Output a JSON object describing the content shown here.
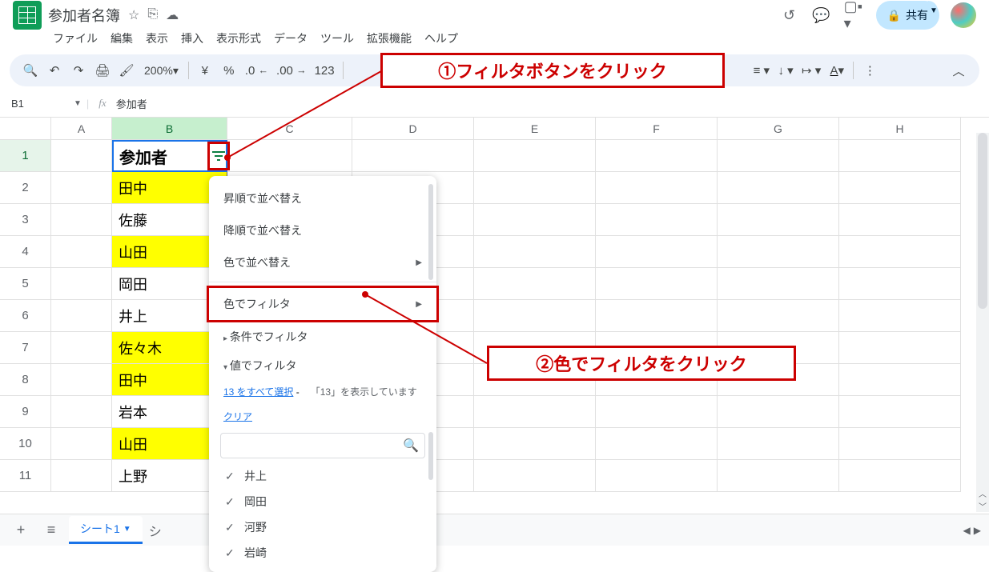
{
  "doc": {
    "title": "参加者名簿"
  },
  "menu": {
    "file": "ファイル",
    "edit": "編集",
    "view": "表示",
    "insert": "挿入",
    "format": "表示形式",
    "data": "データ",
    "tools": "ツール",
    "ext": "拡張機能",
    "help": "ヘルプ"
  },
  "toolbar": {
    "zoom": "200%",
    "yen": "¥",
    "pct": "%",
    "dec_dec": ".0",
    "dec_inc": ".00",
    "num": "123"
  },
  "namebox": {
    "cell": "B1",
    "value": "参加者"
  },
  "columns": [
    "A",
    "B",
    "C",
    "D",
    "E",
    "F",
    "G",
    "H"
  ],
  "rows": [
    {
      "n": "1",
      "b": "参加者",
      "hl": false,
      "head": true
    },
    {
      "n": "2",
      "b": "田中",
      "hl": true
    },
    {
      "n": "3",
      "b": "佐藤",
      "hl": false
    },
    {
      "n": "4",
      "b": "山田",
      "hl": true
    },
    {
      "n": "5",
      "b": "岡田",
      "hl": false
    },
    {
      "n": "6",
      "b": "井上",
      "hl": false
    },
    {
      "n": "7",
      "b": "佐々木",
      "hl": true
    },
    {
      "n": "8",
      "b": "田中",
      "hl": true
    },
    {
      "n": "9",
      "b": "岩本",
      "hl": false
    },
    {
      "n": "10",
      "b": "山田",
      "hl": true
    },
    {
      "n": "11",
      "b": "上野",
      "hl": false
    }
  ],
  "filterMenu": {
    "sortAsc": "昇順で並べ替え",
    "sortDesc": "降順で並べ替え",
    "sortColor": "色で並べ替え",
    "filterColor": "色でフィルタ",
    "filterCond": "条件でフィルタ",
    "filterVal": "値でフィルタ",
    "selectAll": "13 をすべて選択",
    "dash": "-",
    "showing": "「13」を表示しています",
    "clear": "クリア",
    "items": [
      "井上",
      "岡田",
      "河野",
      "岩崎"
    ]
  },
  "callouts": {
    "c1": "①フィルタボタンをクリック",
    "c2": "②色でフィルタをクリック"
  },
  "share": {
    "label": "共有"
  },
  "tabs": {
    "sheet1": "シート1",
    "next": "シ"
  }
}
